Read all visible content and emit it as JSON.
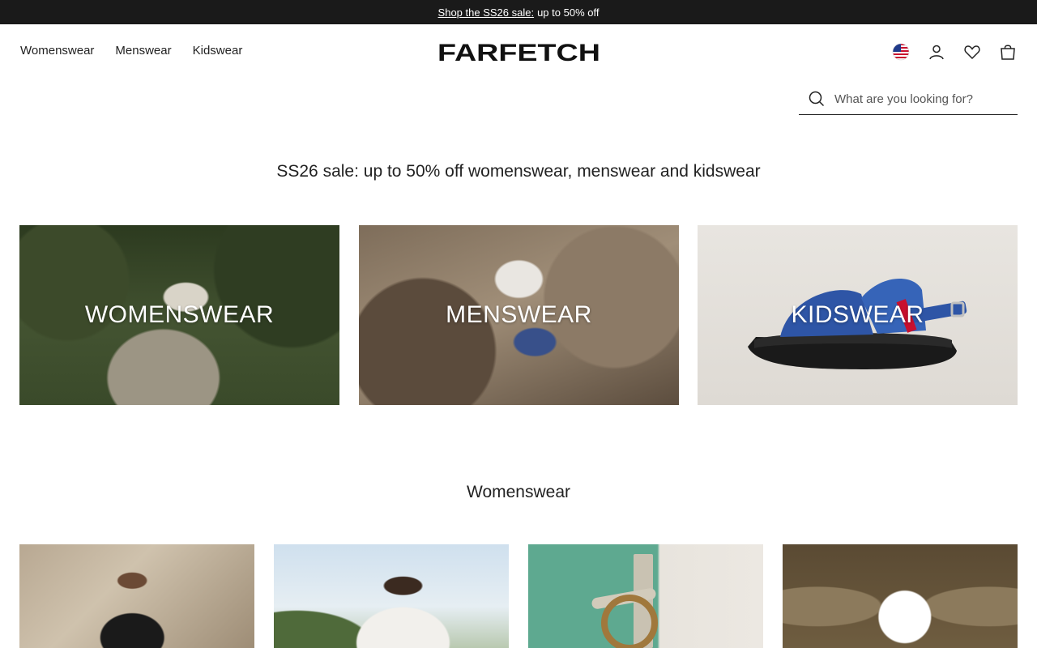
{
  "promo": {
    "link_text": "Shop the SS26 sale:",
    "text": "up to 50% off"
  },
  "nav": {
    "items": [
      {
        "label": "Womenswear"
      },
      {
        "label": "Menswear"
      },
      {
        "label": "Kidswear"
      }
    ]
  },
  "logo": {
    "text": "FARFETCH"
  },
  "header_icons": [
    "us-flag-icon",
    "account-icon",
    "wishlist-heart-icon",
    "bag-icon"
  ],
  "search": {
    "placeholder": "What are you looking for?",
    "value": ""
  },
  "headline": "SS26 sale: up to 50% off womenswear, menswear and kidswear",
  "categories": [
    {
      "label": "WOMENSWEAR"
    },
    {
      "label": "MENSWEAR"
    },
    {
      "label": "KIDSWEAR"
    }
  ],
  "section": {
    "title": "Womenswear"
  },
  "colors": {
    "promo_bg": "#1a1a1a",
    "text": "#222222",
    "background": "#ffffff"
  }
}
